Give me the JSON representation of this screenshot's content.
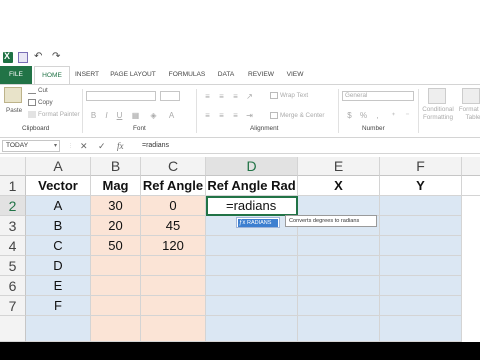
{
  "ribbon_tabs": [
    "FILE",
    "HOME",
    "INSERT",
    "PAGE LAYOUT",
    "FORMULAS",
    "DATA",
    "REVIEW",
    "VIEW"
  ],
  "ribbon": {
    "paste": "Paste",
    "cut": "Cut",
    "copy": "Copy",
    "format_painter": "Format Painter",
    "clipboard_label": "Clipboard",
    "font_label": "Font",
    "wrap_text": "Wrap Text",
    "merge_center": "Merge & Center",
    "alignment_label": "Alignment",
    "number_format": "General",
    "number_label": "Number",
    "conditional_formatting": "Conditional Formatting",
    "format_as_table": "Format as Table"
  },
  "formula_bar": {
    "name_box": "TODAY",
    "cancel": "✕",
    "enter": "✓",
    "fx": "fx",
    "formula": "=radians"
  },
  "columns": [
    "A",
    "B",
    "C",
    "D",
    "E",
    "F"
  ],
  "rows": [
    "1",
    "2",
    "3",
    "4",
    "5",
    "6",
    "7"
  ],
  "cells": {
    "headers": [
      "Vector",
      "Mag",
      "Ref Angle",
      "Ref Angle Rad",
      "X",
      "Y"
    ],
    "vectors": [
      "A",
      "B",
      "C",
      "D",
      "E",
      "F"
    ],
    "mag": [
      "30",
      "20",
      "50"
    ],
    "ref_angle": [
      "0",
      "45",
      "120"
    ],
    "editing_value": "=radians"
  },
  "autocomplete": {
    "function_name": "RADIANS",
    "tooltip": "Converts degrees to radians"
  },
  "colors": {
    "accent": "#217346",
    "blue_fill": "#dbe7f3",
    "peach_fill": "#fbe4d6"
  }
}
